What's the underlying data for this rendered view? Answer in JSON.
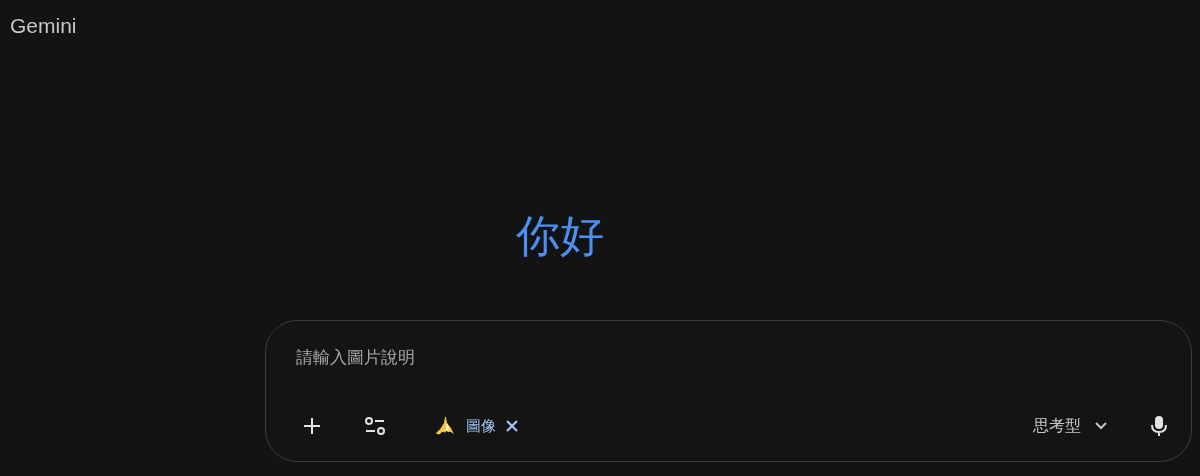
{
  "app": {
    "title": "Gemini"
  },
  "greeting": "你好",
  "composer": {
    "placeholder": "請輸入圖片說明",
    "tool_chip": {
      "label": "圖像"
    },
    "mode": {
      "label": "思考型"
    }
  }
}
